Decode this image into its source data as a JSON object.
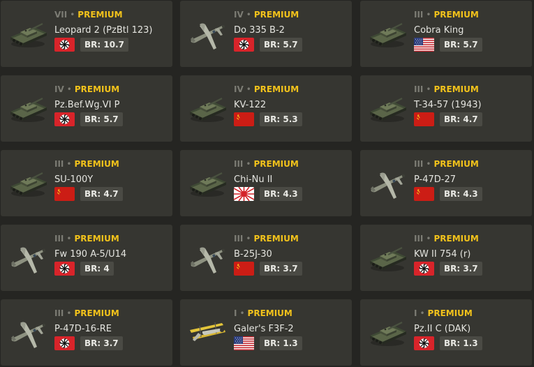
{
  "cards": [
    {
      "rank": "VII",
      "label": "PREMIUM",
      "name": "Leopard 2 (PzBtl 123)",
      "nation": "germany",
      "br": "BR: 10.7",
      "icon": "tank-icon"
    },
    {
      "rank": "IV",
      "label": "PREMIUM",
      "name": "Do 335 B-2",
      "nation": "germany",
      "br": "BR: 5.7",
      "icon": "aircraft-icon"
    },
    {
      "rank": "III",
      "label": "PREMIUM",
      "name": "Cobra King",
      "nation": "usa",
      "br": "BR: 5.7",
      "icon": "tank-icon"
    },
    {
      "rank": "IV",
      "label": "PREMIUM",
      "name": "Pz.Bef.Wg.VI P",
      "nation": "germany",
      "br": "BR: 5.7",
      "icon": "tank-icon"
    },
    {
      "rank": "IV",
      "label": "PREMIUM",
      "name": "KV-122",
      "nation": "ussr",
      "br": "BR: 5.3",
      "icon": "tank-icon"
    },
    {
      "rank": "III",
      "label": "PREMIUM",
      "name": "T-34-57 (1943)",
      "nation": "ussr",
      "br": "BR: 4.7",
      "icon": "tank-icon"
    },
    {
      "rank": "III",
      "label": "PREMIUM",
      "name": "SU-100Y",
      "nation": "ussr",
      "br": "BR: 4.7",
      "icon": "tank-icon"
    },
    {
      "rank": "III",
      "label": "PREMIUM",
      "name": "Chi-Nu II",
      "nation": "japan",
      "br": "BR: 4.3",
      "icon": "tank-icon"
    },
    {
      "rank": "III",
      "label": "PREMIUM",
      "name": "P-47D-27",
      "nation": "ussr",
      "br": "BR: 4.3",
      "icon": "aircraft-icon"
    },
    {
      "rank": "III",
      "label": "PREMIUM",
      "name": "Fw 190 A-5/U14",
      "nation": "germany",
      "br": "BR: 4",
      "icon": "aircraft-icon"
    },
    {
      "rank": "III",
      "label": "PREMIUM",
      "name": "B-25J-30",
      "nation": "ussr",
      "br": "BR: 3.7",
      "icon": "aircraft-icon"
    },
    {
      "rank": "III",
      "label": "PREMIUM",
      "name": "KW II 754 (r)",
      "nation": "germany",
      "br": "BR: 3.7",
      "icon": "tank-icon"
    },
    {
      "rank": "III",
      "label": "PREMIUM",
      "name": "P-47D-16-RE",
      "nation": "germany",
      "br": "BR: 3.7",
      "icon": "aircraft-icon"
    },
    {
      "rank": "I",
      "label": "PREMIUM",
      "name": "Galer's F3F-2",
      "nation": "usa",
      "br": "BR: 1.3",
      "icon": "biplane-icon"
    },
    {
      "rank": "I",
      "label": "PREMIUM",
      "name": "Pz.II C (DAK)",
      "nation": "germany",
      "br": "BR: 1.3",
      "icon": "tank-icon"
    }
  ],
  "separator": "•",
  "colors": {
    "premium": "#f2c21b",
    "card": "#363631",
    "background": "#252522",
    "br_badge": "#4a4a44"
  }
}
